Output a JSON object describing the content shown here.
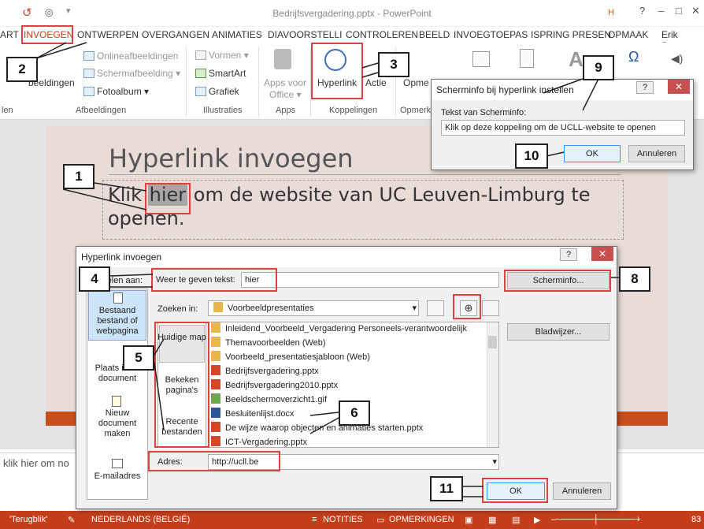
{
  "window": {
    "title": "Bedrijfsvergadering.pptx - PowerPoint",
    "home_badge": "H",
    "min": "–",
    "max": "□",
    "close": "✕",
    "help": "?",
    "restore": "▭"
  },
  "tabs": [
    "ART",
    "INVOEGEN",
    "ONTWERPEN",
    "OVERGANGEN",
    "ANIMATIES",
    "DIAVOORSTELLI",
    "CONTROLEREN",
    "BEELD",
    "INVOEGTOEPAS",
    "ISPRING PRESEN",
    "OPMAAK",
    "Erik Penen"
  ],
  "ribbon": {
    "afbeeldingen_btn": "beeldingen",
    "online": "Onlineafbeeldingen",
    "scherm": "Schermafbeelding",
    "foto": "Fotoalbum",
    "vormen": "Vormen",
    "smartart": "SmartArt",
    "grafiek": "Grafiek",
    "apps_voor": "Apps voor",
    "office": "Office",
    "hyperlink": "Hyperlink",
    "actie": "Actie",
    "opme": "Opme",
    "groups": {
      "len": "len",
      "afbeeldingen": "Afbeeldingen",
      "illustraties": "Illustraties",
      "apps": "Apps",
      "koppelingen": "Koppelingen",
      "opmerk": "Opmerk"
    }
  },
  "slide": {
    "title": "Hyperlink invoegen",
    "body_pre": "Klik ",
    "body_sel": "hier",
    "body_post": " om de website van UC Leuven-Limburg te openen."
  },
  "notes": "klik hier om no",
  "status": {
    "back": "'Terugblik'",
    "lang": "NEDERLANDS (BELGIË)",
    "notities": "NOTITIES",
    "opmerkingen": "OPMERKINGEN",
    "zoom": "83"
  },
  "screentip_dialog": {
    "title": "Scherminfo bij hyperlink instellen",
    "label": "Tekst van Scherminfo:",
    "value": "Klik op deze koppeling om de UCLL-website te openen",
    "ok": "OK",
    "cancel": "Annuleren"
  },
  "hyperlink_dialog": {
    "title": "Hyperlink invoegen",
    "koppelen_aan": "Koppelen aan:",
    "display_label": "Weer te geven tekst:",
    "display_value": "hier",
    "screentip_btn": "Scherminfo...",
    "look_in_label": "Zoeken in:",
    "look_in_value": "Voorbeeldpresentaties",
    "bookmark_btn": "Bladwijzer...",
    "nav": [
      "Bestaand bestand of webpagina",
      "Plaats in dit document",
      "Nieuw document maken",
      "E-mailadres"
    ],
    "nav_short": {
      "plaats": "Plaats in dit",
      "document": "document"
    },
    "subnav": [
      "Huidige map",
      "Bekeken pagina's",
      "Recente bestanden"
    ],
    "files": [
      {
        "name": "Inleidend_Voorbeeld_Vergadering Personeels-verantwoordelijk",
        "type": "folder"
      },
      {
        "name": "Themavoorbeelden (Web)",
        "type": "folder"
      },
      {
        "name": "Voorbeeld_presentatiesjabloon (Web)",
        "type": "folder"
      },
      {
        "name": "Bedrijfsvergadering.pptx",
        "type": "ppt"
      },
      {
        "name": "Bedrijfsvergadering2010.pptx",
        "type": "ppt"
      },
      {
        "name": "Beeldschermoverzicht1.gif",
        "type": "gif"
      },
      {
        "name": "Besluitenlijst.docx",
        "type": "doc"
      },
      {
        "name": "De wijze waarop objecten en animaties starten.pptx",
        "type": "ppt"
      },
      {
        "name": "ICT-Vergadering.pptx",
        "type": "ppt"
      }
    ],
    "address_label": "Adres:",
    "address_value": "http://ucll.be",
    "ok": "OK",
    "cancel": "Annuleren"
  },
  "callouts": [
    "1",
    "2",
    "3",
    "4",
    "5",
    "6",
    "8",
    "9",
    "10",
    "11"
  ],
  "colors": {
    "accent": "#c43e1c",
    "highlight": "#e04040"
  }
}
